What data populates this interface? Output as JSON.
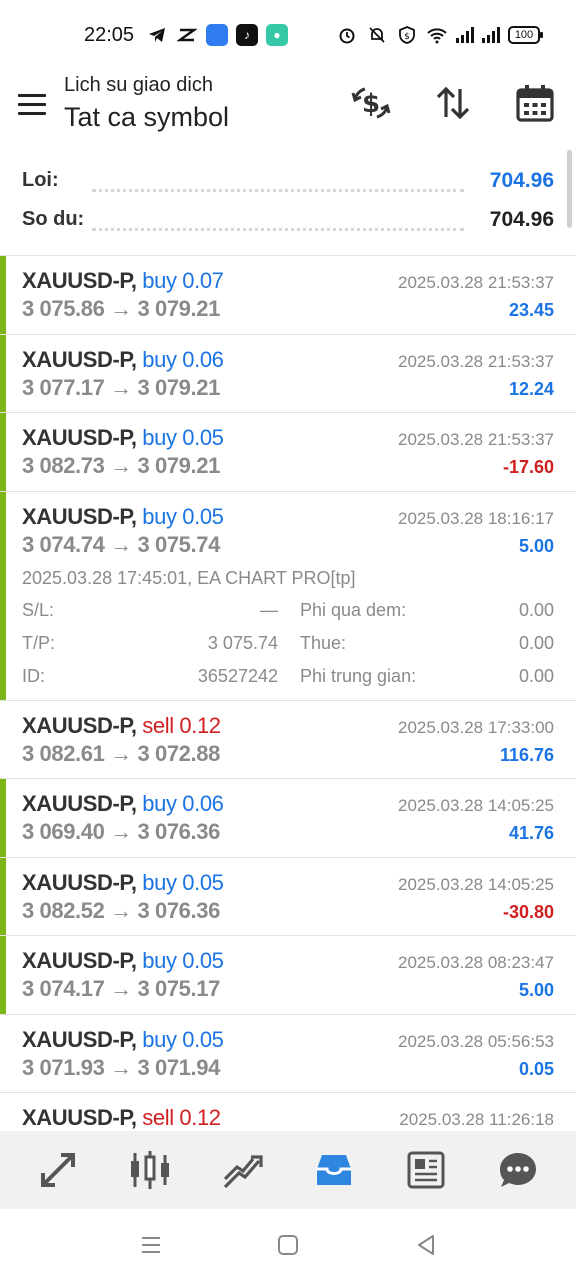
{
  "status_bar": {
    "time": "22:05",
    "battery": "100",
    "left_icons": [
      "telegram-icon",
      "capcut-icon",
      "app-icon",
      "tiktok-icon",
      "chat-app-icon"
    ],
    "right_icons": [
      "alarm-icon",
      "bell-off-icon",
      "shield-icon",
      "wifi-icon",
      "signal-icon",
      "signal-icon",
      "battery-icon"
    ]
  },
  "header": {
    "title": "Lich su giao dich",
    "subtitle": "Tat ca symbol",
    "actions": [
      "currency-exchange-icon",
      "sort-icon",
      "calendar-icon"
    ]
  },
  "summary": {
    "profit_label": "Loi:",
    "profit_value": "704.96",
    "balance_label": "So du:",
    "balance_value": "704.96"
  },
  "colors": {
    "accent_blue": "#1b74e4",
    "loss_red": "#d11f1f",
    "buy_bar_green": "#7cb518",
    "muted_gray": "#8a8a8a"
  },
  "trades": [
    {
      "symbol": "XAUUSD-P,",
      "direction": "buy 0.07",
      "type": "buy",
      "prices": "3 075.86 → 3 079.21",
      "time": "2025.03.28 21:53:37",
      "profit": "23.45",
      "profit_sign": "pos",
      "bar": true
    },
    {
      "symbol": "XAUUSD-P,",
      "direction": "buy 0.06",
      "type": "buy",
      "prices": "3 077.17 → 3 079.21",
      "time": "2025.03.28 21:53:37",
      "profit": "12.24",
      "profit_sign": "pos",
      "bar": true
    },
    {
      "symbol": "XAUUSD-P,",
      "direction": "buy 0.05",
      "type": "buy",
      "prices": "3 082.73 → 3 079.21",
      "time": "2025.03.28 21:53:37",
      "profit": "-17.60",
      "profit_sign": "neg",
      "bar": true
    },
    {
      "symbol": "XAUUSD-P,",
      "direction": "buy 0.05",
      "type": "buy",
      "prices": "3 074.74 → 3 075.74",
      "time": "2025.03.28 18:16:17",
      "profit": "5.00",
      "profit_sign": "pos",
      "bar": true,
      "details": {
        "comment": "2025.03.28 17:45:01, EA CHART PRO[tp]",
        "sl_label": "S/L:",
        "sl_value": "—",
        "tp_label": "T/P:",
        "tp_value": "3 075.74",
        "id_label": "ID:",
        "id_value": "36527242",
        "swap_label": "Phi qua dem:",
        "swap_value": "0.00",
        "tax_label": "Thue:",
        "tax_value": "0.00",
        "commission_label": "Phi trung gian:",
        "commission_value": "0.00"
      }
    },
    {
      "symbol": "XAUUSD-P,",
      "direction": "sell 0.12",
      "type": "sell",
      "prices": "3 082.61 → 3 072.88",
      "time": "2025.03.28 17:33:00",
      "profit": "116.76",
      "profit_sign": "pos",
      "bar": false
    },
    {
      "symbol": "XAUUSD-P,",
      "direction": "buy 0.06",
      "type": "buy",
      "prices": "3 069.40 → 3 076.36",
      "time": "2025.03.28 14:05:25",
      "profit": "41.76",
      "profit_sign": "pos",
      "bar": true
    },
    {
      "symbol": "XAUUSD-P,",
      "direction": "buy 0.05",
      "type": "buy",
      "prices": "3 082.52 → 3 076.36",
      "time": "2025.03.28 14:05:25",
      "profit": "-30.80",
      "profit_sign": "neg",
      "bar": true
    },
    {
      "symbol": "XAUUSD-P,",
      "direction": "buy 0.05",
      "type": "buy",
      "prices": "3 074.17 → 3 075.17",
      "time": "2025.03.28 08:23:47",
      "profit": "5.00",
      "profit_sign": "pos",
      "bar": true
    },
    {
      "symbol": "XAUUSD-P,",
      "direction": "buy 0.05",
      "type": "buy",
      "prices": "3 071.93 → 3 071.94",
      "time": "2025.03.28 05:56:53",
      "profit": "0.05",
      "profit_sign": "pos",
      "bar": false
    },
    {
      "symbol": "XAUUSD-P,",
      "direction": "sell 0.12",
      "type": "sell",
      "prices": "",
      "time": "2025.03.28 11:26:18",
      "profit": "",
      "profit_sign": "pos",
      "bar": false
    }
  ],
  "bottom_nav": [
    "quotes-icon",
    "chart-icon",
    "trade-icon",
    "history-icon",
    "news-icon",
    "messages-icon"
  ],
  "bottom_nav_active": 3,
  "system_nav": [
    "recents-icon",
    "home-icon",
    "back-icon"
  ]
}
